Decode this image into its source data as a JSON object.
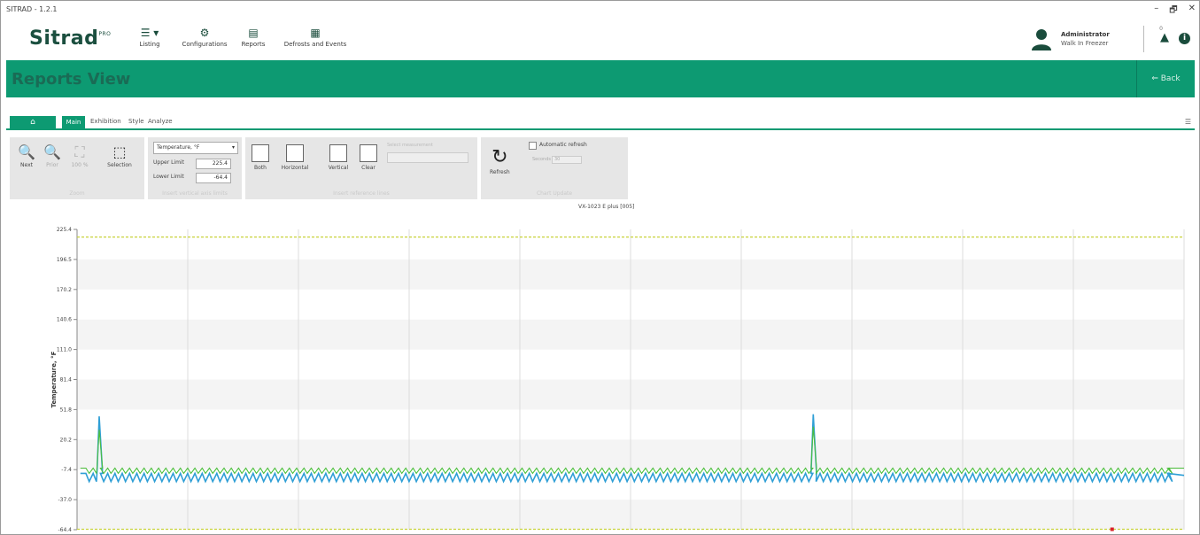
{
  "window": {
    "title": "SITRAD - 1.2.1",
    "controls": [
      "–",
      "🗗",
      "✕"
    ]
  },
  "nav": {
    "logo": "Sitrad",
    "logo_sup": "PRO",
    "items": [
      {
        "label": "Listing",
        "icon": "list-icon"
      },
      {
        "label": "Configurations",
        "icon": "gear-icon"
      },
      {
        "label": "Reports",
        "icon": "report-icon"
      },
      {
        "label": "Defrosts and Events",
        "icon": "calendar-icon"
      }
    ],
    "user": {
      "name": "Administrator",
      "sub": "Walk In Freezer"
    },
    "alert_count": "0",
    "info": "i"
  },
  "header": {
    "title": "Reports View",
    "back": "⇐  Back"
  },
  "tabs": {
    "home": "⌂",
    "items": [
      "Main",
      "Exhibition",
      "Style",
      "Analyze"
    ],
    "menu": "☰"
  },
  "ribbon": {
    "zoom": {
      "buttons": [
        {
          "label": "Next",
          "icon": "zoom-in-icon",
          "glyph": "🔍"
        },
        {
          "label": "Prior",
          "icon": "zoom-out-icon",
          "glyph": "🔍"
        },
        {
          "label": "100 %",
          "icon": "zoom-reset-icon",
          "glyph": "⛶"
        },
        {
          "label": "Selection",
          "icon": "selection-icon",
          "glyph": "⬚"
        }
      ],
      "group_label": "Zoom"
    },
    "axis": {
      "select": "Temperature, °F",
      "upper_label": "Upper Limit",
      "upper_value": "225.4",
      "lower_label": "Lower Limit",
      "lower_value": "-64.4",
      "group_label": "Insert vertical axis limits"
    },
    "ref_lines": {
      "buttons": [
        "Both",
        "Horizontal",
        "Vertical",
        "Clear"
      ],
      "select_label": "Select measurement",
      "group_label": "Insert reference lines"
    },
    "update": {
      "refresh": "Refresh",
      "auto_refresh": "Automatic refresh",
      "seconds_label": "Seconds",
      "seconds_value": "30",
      "group_label": "Chart Update"
    }
  },
  "chart_data": {
    "type": "line",
    "title": "VX-1023 E plus [005]",
    "ylabel": "Temperature, °F",
    "ylim": [
      -64.4,
      225.4
    ],
    "y_ticks": [
      "225.4",
      "196.5",
      "170.2",
      "140.6",
      "111.0",
      "81.4",
      "51.8",
      "20.2",
      "-7.4",
      "-37.0",
      "-64.4"
    ],
    "reference_lines": [
      {
        "name": "upper",
        "value": 218,
        "color": "#c8d23a"
      },
      {
        "name": "lower",
        "value": -64,
        "color": "#c8d23a"
      }
    ],
    "series": [
      {
        "color": "#2f9fd6",
        "baseline": -10,
        "low": -18,
        "spikes": [
          {
            "at": 0.02,
            "value": 45
          },
          {
            "at": 0.665,
            "value": 47
          }
        ],
        "cycles": 150,
        "end": 0.985
      },
      {
        "color": "#4cbf3c",
        "baseline": -5,
        "low": -10,
        "spikes": [
          {
            "at": 0.02,
            "value": 32
          },
          {
            "at": 0.665,
            "value": 35
          }
        ],
        "cycles": 150,
        "end": 0.985
      }
    ],
    "vertical_grid_count": 10,
    "marker": {
      "at": 0.935,
      "value": -64,
      "color": "#d9202a"
    }
  }
}
